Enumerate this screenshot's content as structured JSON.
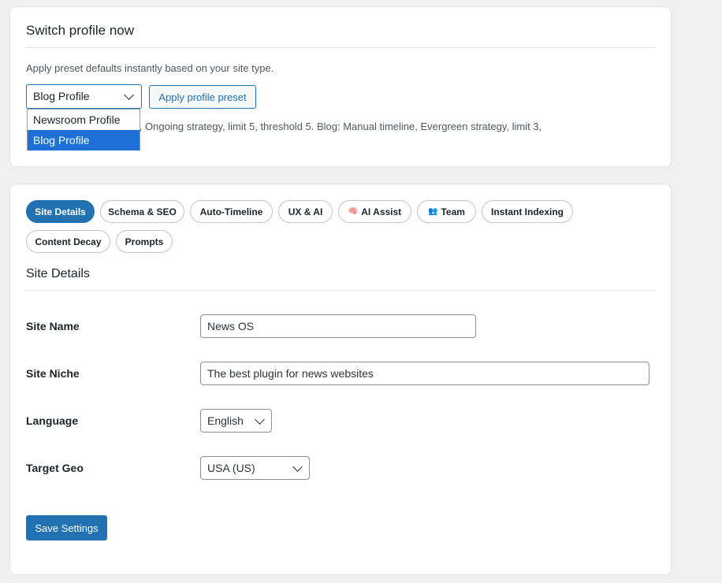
{
  "switch_profile": {
    "title": "Switch profile now",
    "description": "Apply preset defaults instantly based on your site type.",
    "select_value": "Blog Profile",
    "apply_button": "Apply profile preset",
    "hint": "Newsroom: Auto timeline, Ongoing strategy, limit 5, threshold 5. Blog: Manual timeline, Evergreen strategy, limit 3,",
    "dropdown_options": [
      "Newsroom Profile",
      "Blog Profile"
    ],
    "dropdown_selected": "Blog Profile"
  },
  "tabs": [
    {
      "label": "Site Details",
      "icon": "",
      "active": true
    },
    {
      "label": "Schema & SEO",
      "icon": ""
    },
    {
      "label": "Auto-Timeline",
      "icon": ""
    },
    {
      "label": "UX & AI",
      "icon": ""
    },
    {
      "label": "AI Assist",
      "icon": "brain-icon"
    },
    {
      "label": "Team",
      "icon": "people-icon"
    },
    {
      "label": "Instant Indexing",
      "icon": ""
    },
    {
      "label": "Content Decay",
      "icon": ""
    },
    {
      "label": "Prompts",
      "icon": ""
    }
  ],
  "site_details": {
    "title": "Site Details",
    "site_name_label": "Site Name",
    "site_name_value": "News OS",
    "site_niche_label": "Site Niche",
    "site_niche_value": "The best plugin for news websites",
    "language_label": "Language",
    "language_value": "English",
    "target_geo_label": "Target Geo",
    "target_geo_value": "USA (US)",
    "save_button": "Save Settings"
  },
  "colors": {
    "accent": "#2271b1",
    "dropdown_highlight": "#1e6fd6",
    "page_bg": "#f0f0f1"
  }
}
